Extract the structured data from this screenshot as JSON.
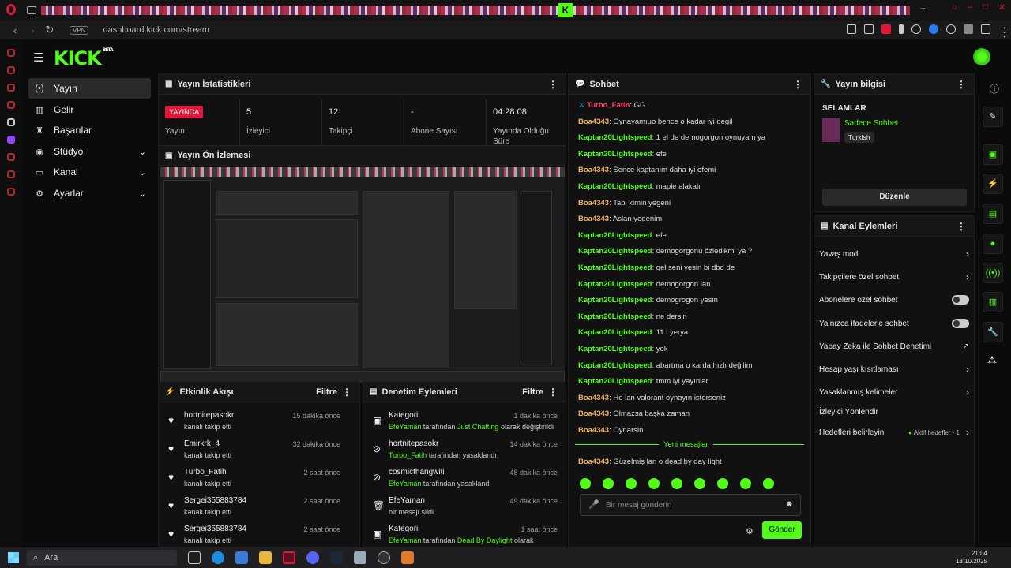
{
  "browser": {
    "url": "dashboard.kick.com/stream",
    "vpn": "VPN",
    "tab_label": "K"
  },
  "app": {
    "logo": "KICK",
    "logo_sup": "BETA"
  },
  "nav": [
    {
      "label": "Yayın",
      "icon": "broadcast-icon"
    },
    {
      "label": "Gelir",
      "icon": "bank-icon"
    },
    {
      "label": "Başarılar",
      "icon": "trophy-icon"
    },
    {
      "label": "Stüdyo",
      "icon": "studio-icon"
    },
    {
      "label": "Kanal",
      "icon": "tv-icon"
    },
    {
      "label": "Ayarlar",
      "icon": "gear-icon"
    }
  ],
  "stats": {
    "title": "Yayın İstatistikleri",
    "live_badge": "YAYINDA",
    "live_label": "Yayın",
    "viewers_value": "5",
    "viewers_label": "İzleyici",
    "followers_value": "12",
    "followers_label": "Takipçi",
    "subs_value": "-",
    "subs_label": "Abone Sayısı",
    "uptime_value": "04:28:08",
    "uptime_label": "Yayında Olduğu Süre"
  },
  "preview": {
    "title": "Yayın Ön İzlemesi"
  },
  "activity": {
    "title": "Etkinlik Akışı",
    "filter": "Filtre",
    "rows": [
      {
        "name": "hortnitepasokr",
        "sub": "kanalı takip etti",
        "time": "15 dakika önce"
      },
      {
        "name": "Emirkrk_4",
        "sub": "kanalı takip etti",
        "time": "32 dakika önce"
      },
      {
        "name": "Turbo_Fatih",
        "sub": "kanalı takip etti",
        "time": "2 saat önce"
      },
      {
        "name": "Sergei355883784",
        "sub": "kanalı takip etti",
        "time": "2 saat önce"
      },
      {
        "name": "Sergei355883784",
        "sub": "kanalı takip etti",
        "time": "2 saat önce"
      }
    ]
  },
  "moderation": {
    "title": "Denetim Eylemleri",
    "filter": "Filtre",
    "rows": [
      {
        "name": "Kategori",
        "actor": "EfeYaman",
        "mid": " tarafından ",
        "obj": "Just Chatting",
        "tail": " olarak değiştirildi",
        "time": "1 dakika önce"
      },
      {
        "name": "hortnitepasokr",
        "actor": "Turbo_Fatih",
        "mid": " tarafından yasaklandı",
        "obj": "",
        "tail": "",
        "time": "14 dakika önce"
      },
      {
        "name": "cosmicthangwiti",
        "actor": "EfeYaman",
        "mid": " tarafından yasaklandı",
        "obj": "",
        "tail": "",
        "time": "48 dakika önce"
      },
      {
        "name": "EfeYaman",
        "actor": "",
        "mid": "bir mesajı sildi",
        "obj": "",
        "tail": "",
        "time": "49 dakika önce"
      },
      {
        "name": "Kategori",
        "actor": "EfeYaman",
        "mid": " tarafından ",
        "obj": "Dead By Daylight",
        "tail": " olarak",
        "time": "1 saat önce"
      }
    ]
  },
  "chat": {
    "title": "Sohbet",
    "messages": [
      {
        "user": "Turbo_Fatih",
        "color": "pk",
        "text": "GG"
      },
      {
        "user": "Boa4343",
        "color": "or",
        "text": "Oynayamıuo bence o kadar iyi degil"
      },
      {
        "user": "Kaptan20Lightspeed",
        "color": "green",
        "text": "1 el de demogorgon oynuyam ya"
      },
      {
        "user": "Kaptan20Lightspeed",
        "color": "green",
        "text": "efe"
      },
      {
        "user": "Boa4343",
        "color": "or",
        "text": "Sence kaptanım daha iyi efemi"
      },
      {
        "user": "Kaptan20Lightspeed",
        "color": "green",
        "text": "maple alakalı"
      },
      {
        "user": "Boa4343",
        "color": "or",
        "text": "Tabi kimin yegeni"
      },
      {
        "user": "Boa4343",
        "color": "or",
        "text": "Aslan yegenim"
      },
      {
        "user": "Kaptan20Lightspeed",
        "color": "green",
        "text": "efe"
      },
      {
        "user": "Kaptan20Lightspeed",
        "color": "green",
        "text": "demogorgonu özledikmi ya ?"
      },
      {
        "user": "Kaptan20Lightspeed",
        "color": "green",
        "text": "gel seni yesin bi dbd de"
      },
      {
        "user": "Kaptan20Lightspeed",
        "color": "green",
        "text": "demogorgon lan"
      },
      {
        "user": "Kaptan20Lightspeed",
        "color": "green",
        "text": "demogrogon yesin"
      },
      {
        "user": "Kaptan20Lightspeed",
        "color": "green",
        "text": "ne dersin"
      },
      {
        "user": "Kaptan20Lightspeed",
        "color": "green",
        "text": "11 i yerya"
      },
      {
        "user": "Kaptan20Lightspeed",
        "color": "green",
        "text": "yok"
      },
      {
        "user": "Kaptan20Lightspeed",
        "color": "green",
        "text": "abartma o karda hızlı değilim"
      },
      {
        "user": "Kaptan20Lightspeed",
        "color": "green",
        "text": "tmm iyi yayınlar"
      },
      {
        "user": "Boa4343",
        "color": "or",
        "text": "He lan valorant oynayın isterseniz"
      },
      {
        "user": "Boa4343",
        "color": "or",
        "text": "Olmazsa başka zaman"
      },
      {
        "user": "Boa4343",
        "color": "or",
        "text": "Oynarsin"
      }
    ],
    "new_messages": "Yeni mesajlar",
    "last_message": {
      "user": "Boa4343",
      "color": "or",
      "text": "Güzelmiş lan o dead by day light"
    },
    "input_placeholder": "Bir mesaj gönderin",
    "send": "Gönder"
  },
  "stream_info": {
    "title": "Yayın bilgisi",
    "stream_title": "SELAMLAR",
    "category": "Sadece Sohbet",
    "tag": "Turkish",
    "edit": "Düzenle"
  },
  "channel_actions": {
    "title": "Kanal Eylemleri",
    "items": [
      {
        "label": "Yavaş mod"
      },
      {
        "label": "Takipçilere özel sohbet"
      },
      {
        "label": "Abonelere özel sohbet"
      },
      {
        "label": "Yalnızca ifadelerle sohbet"
      },
      {
        "label": "Yapay Zeka ile Sohbet Denetimi"
      },
      {
        "label": "Hesap yaşı kısıtlaması"
      },
      {
        "label": "Yasaklanmış kelimeler"
      },
      {
        "label": "İzleyici Yönlendir"
      },
      {
        "label": "Hedefleri belirleyin"
      }
    ],
    "active_goals": "Aktif hedefler - 1"
  },
  "taskbar": {
    "search": "Ara",
    "time": "21:04",
    "date": "13.10.2025"
  },
  "colors": {
    "accent": "#53fc18",
    "live": "#e0173a"
  }
}
